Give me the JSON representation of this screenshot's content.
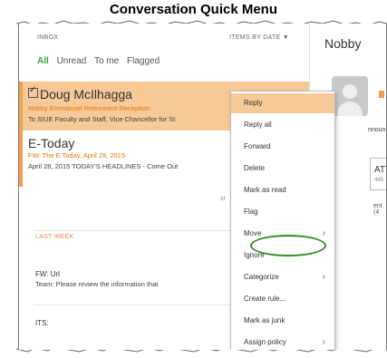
{
  "caption": "Conversation Quick Menu",
  "list": {
    "inbox_label": "INBOX",
    "sort_label": "ITEMS BY DATE",
    "sort_icon": "caret-down-icon",
    "filters": [
      "All",
      "Unread",
      "To me",
      "Flagged"
    ],
    "active_filter": "All",
    "messages": [
      {
        "sender": "Doug McIlhagga",
        "subject": "Nobby Emmanuel Retirement Reception",
        "preview": "To SIUE Faculty and Staff, Vice Chancellor for St",
        "selected": true
      },
      {
        "sender": "E-Today",
        "subject": "FW: The E Today, April 28, 2015",
        "preview": "April 28, 2015 TODAY'S HEADLINES - Come Out"
      }
    ],
    "s_mark": "sr",
    "group_label": "LAST WEEK",
    "msg3": {
      "subject": "FW: Url",
      "preview": "Team: Please review the information that"
    },
    "msg4": {
      "subject": "ITS:"
    }
  },
  "reading": {
    "sender": "Nobby",
    "announce": "nnounc",
    "attachment_title": "ATT",
    "attachment_size": "445",
    "ment_text": "ent (4"
  },
  "menu": {
    "items": [
      {
        "label": "Reply",
        "highlight": true
      },
      {
        "label": "Reply all"
      },
      {
        "label": "Forward"
      },
      {
        "label": "Delete"
      },
      {
        "label": "Mark as read"
      },
      {
        "label": "Flag"
      },
      {
        "label": "Move",
        "submenu": true
      },
      {
        "label": "Ignore"
      },
      {
        "label": "Categorize",
        "submenu": true
      },
      {
        "label": "Create rule...",
        "circled": true
      },
      {
        "label": "Mark as junk"
      },
      {
        "label": "Assign policy",
        "submenu": true
      }
    ],
    "submenu_glyph": "›"
  },
  "colors": {
    "selected_row": "#f7c996",
    "accent_orange": "#f0a050",
    "filter_active": "#3aa33a",
    "circle_green": "#3a8a2a"
  }
}
